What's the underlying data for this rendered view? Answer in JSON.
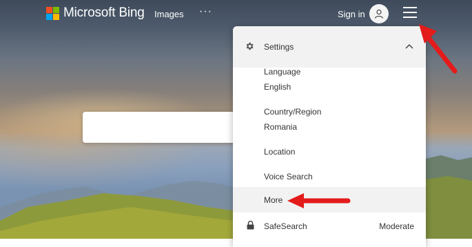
{
  "header": {
    "logo_text": "Microsoft Bing",
    "nav_images": "Images",
    "nav_more": "···",
    "signin_label": "Sign in"
  },
  "menu": {
    "settings_label": "Settings",
    "items": {
      "language_label": "Language",
      "language_value": "English",
      "country_label": "Country/Region",
      "country_value": "Romania",
      "location_label": "Location",
      "voice_label": "Voice Search",
      "more_label": "More"
    },
    "safesearch": {
      "label": "SafeSearch",
      "value": "Moderate"
    }
  },
  "colors": {
    "ms_red": "#f25022",
    "ms_green": "#7fba00",
    "ms_blue": "#00a4ef",
    "ms_yellow": "#ffb900",
    "arrow_red": "#e41b1b",
    "menu_highlight": "#f2f2f2"
  },
  "icons": {
    "gear": "gear-icon",
    "chevron": "chevron-up-icon",
    "lock": "lock-icon",
    "avatar": "user-icon",
    "menu": "hamburger-icon"
  }
}
